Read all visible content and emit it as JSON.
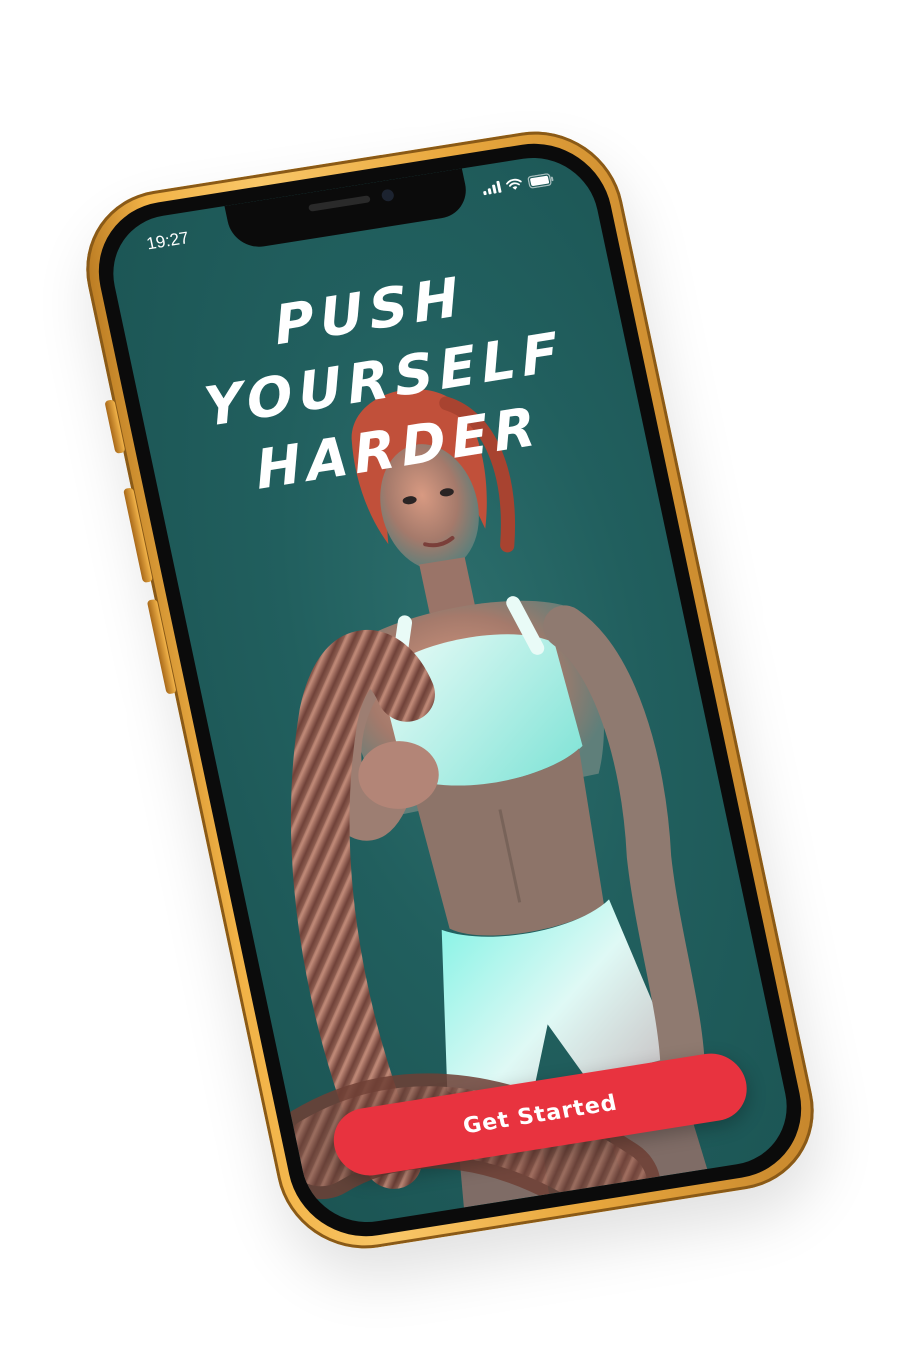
{
  "status_bar": {
    "time": "19:27",
    "icons": [
      "cellular-signal-icon",
      "wifi-icon",
      "battery-icon"
    ]
  },
  "hero": {
    "headline_lines": [
      "PUSH",
      "YOURSELF",
      "HARDER"
    ]
  },
  "cta": {
    "label": "Get Started"
  },
  "colors": {
    "phone_gold": "#f2b347",
    "screen_bg": "#215f5e",
    "cta_red": "#e8333f",
    "text_white": "#ffffff"
  }
}
